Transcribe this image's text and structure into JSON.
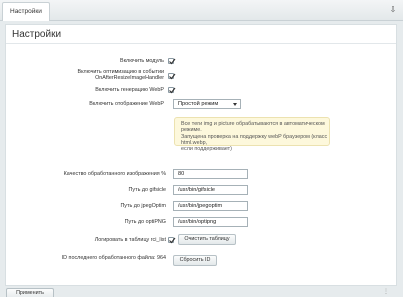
{
  "tabs": [
    {
      "label": "Настройки"
    }
  ],
  "page_title": "Настройки",
  "settings": {
    "enable_module_label": "Включить модуль",
    "enable_optimization_label_line1": "Включить оптимизацию в событии",
    "enable_optimization_label_line2": "OnAfterResizeImageHandler",
    "enable_webp_label": "Включить генерацию WebP",
    "webp_display_label": "Включить отображение WebP",
    "webp_display_value": "Простой режим",
    "note_line1": "Все теги img и picture обрабатываются в автоматическом режиме.",
    "note_line2": "Запущена проверка на поддержку webP браузером (класс html.webp,",
    "note_line3": "если поддерживает)",
    "quality_label": "Качество обработанного изображения %",
    "quality_value": "80",
    "gifsicle_label": "Путь до gifsicle",
    "gifsicle_value": "/usr/bin/gifsicle",
    "jpegoptim_label": "Путь до jpegOptim",
    "jpegoptim_value": "/usr/bin/jpegoptim",
    "optipng_label": "Путь до optiPNG",
    "optipng_value": "/usr/bin/optipng",
    "log_label": "Логировать в таблицу rci_list",
    "clear_table_button": "Очистить таблицу",
    "last_file_label": "ID последнего обработанного файла: 964",
    "reset_id_button": "Сбросить ID"
  },
  "footer": {
    "apply_button": "Применить"
  },
  "checkboxes": {
    "enable_module": true,
    "enable_optimization": true,
    "enable_webp": true,
    "log_table": true
  }
}
